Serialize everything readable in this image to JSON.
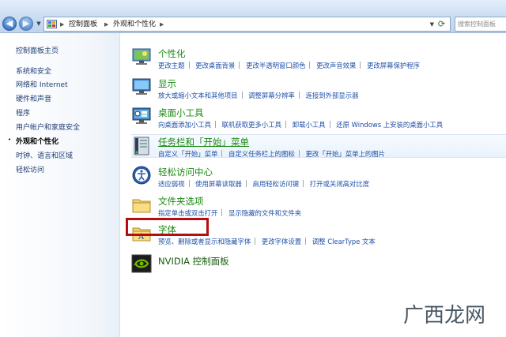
{
  "address": {
    "segments": [
      "控制面板",
      "外观和个性化"
    ],
    "search_placeholder": "搜索控制面板"
  },
  "sidebar": {
    "items": [
      {
        "label": "控制面板主页"
      },
      {
        "label": "系统和安全"
      },
      {
        "label": "网络和 Internet"
      },
      {
        "label": "硬件和声音"
      },
      {
        "label": "程序"
      },
      {
        "label": "用户帐户和家庭安全"
      },
      {
        "label": "外观和个性化",
        "current": true
      },
      {
        "label": "时钟、语言和区域"
      },
      {
        "label": "轻松访问"
      }
    ]
  },
  "categories": [
    {
      "title": "个性化",
      "icon": "personalization-icon",
      "links": [
        "更改主题",
        "更改桌面背景",
        "更改半透明窗口颜色",
        "更改声音效果",
        "更改屏幕保护程序"
      ]
    },
    {
      "title": "显示",
      "icon": "display-icon",
      "links": [
        "放大或缩小文本和其他项目",
        "调整屏幕分辨率",
        "连接到外部显示器"
      ]
    },
    {
      "title": "桌面小工具",
      "icon": "gadgets-icon",
      "links": [
        "向桌面添加小工具",
        "联机获取更多小工具",
        "卸载小工具",
        "还原 Windows 上安装的桌面小工具"
      ]
    },
    {
      "title": "任务栏和「开始」菜单",
      "icon": "taskbar-icon",
      "links": [
        "自定义「开始」菜单",
        "自定义任务栏上的图标",
        "更改「开始」菜单上的图片"
      ]
    },
    {
      "title": "轻松访问中心",
      "icon": "ease-of-access-icon",
      "links": [
        "适应弱视",
        "使用屏幕读取器",
        "启用轻松访问键",
        "打开或关闭高对比度"
      ]
    },
    {
      "title": "文件夹选项",
      "icon": "folder-options-icon",
      "links": [
        "指定单击或双击打开",
        "显示隐藏的文件和文件夹"
      ]
    },
    {
      "title": "字体",
      "icon": "fonts-folder-icon",
      "links": [
        "预览、删除或者显示和隐藏字体",
        "更改字体设置",
        "调整 ClearType 文本"
      ]
    },
    {
      "title": "NVIDIA 控制面板",
      "icon": "nvidia-icon",
      "links": []
    }
  ],
  "watermark": {
    "text": "广西龙网"
  },
  "colors": {
    "title_green": "#1a8a10",
    "link_blue": "#1e4fa6",
    "highlight_red": "#b50e0e"
  }
}
